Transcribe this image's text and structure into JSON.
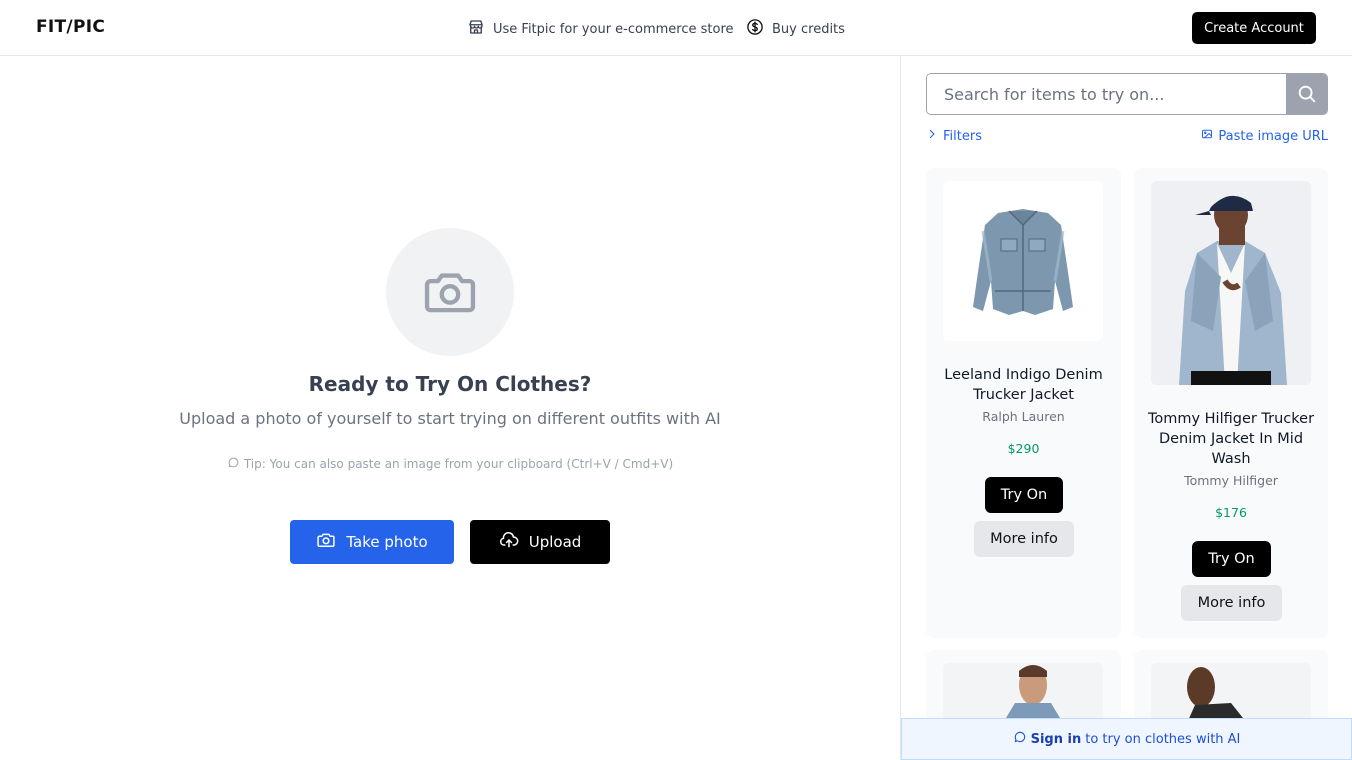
{
  "header": {
    "logo": "FIT/PIC",
    "store_link": "Use Fitpic for your e-commerce store",
    "credits_link": "Buy credits",
    "create_account": "Create Account"
  },
  "main": {
    "title": "Ready to Try On Clothes?",
    "subtitle": "Upload a photo of yourself to start trying on different outfits with AI",
    "tip": "Tip: You can also paste an image from your clipboard (Ctrl+V / Cmd+V)",
    "take_photo": "Take photo",
    "upload": "Upload"
  },
  "sidebar": {
    "search_placeholder": "Search for items to try on...",
    "filters": "Filters",
    "paste_url": "Paste image URL",
    "products": [
      {
        "name": "Leeland Indigo Denim Trucker Jacket",
        "brand": "Ralph Lauren",
        "price": "$290",
        "try_on": "Try On",
        "more_info": "More info"
      },
      {
        "name": "Tommy Hilfiger Trucker Denim Jacket In Mid Wash",
        "brand": "Tommy Hilfiger",
        "price": "$176",
        "try_on": "Try On",
        "more_info": "More info"
      }
    ]
  },
  "banner": {
    "signin": "Sign in",
    "rest": "to try on clothes with AI"
  },
  "colors": {
    "primary_blue": "#2563eb",
    "price_green": "#059669",
    "black": "#000000"
  }
}
